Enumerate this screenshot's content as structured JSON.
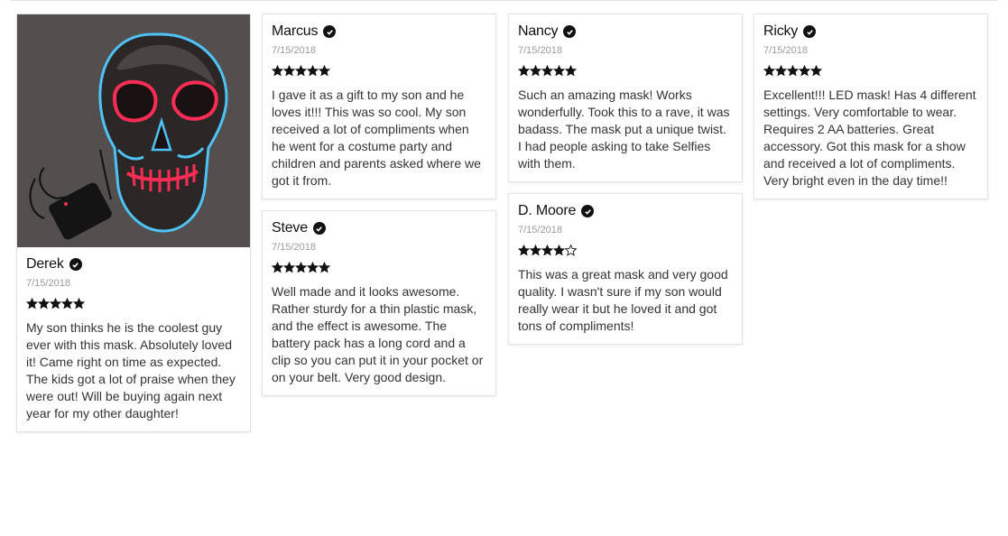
{
  "reviews": [
    {
      "name": "Derek",
      "date": "7/15/2018",
      "rating": 5,
      "text": "My son thinks he is the coolest guy ever with this mask. Absolutely loved it! Came right on time as expected. The kids got a lot of praise when they were out! Will be buying again next year for my other daughter!",
      "photo": "glowing-skull-mask-photo"
    },
    {
      "name": "Marcus",
      "date": "7/15/2018",
      "rating": 5,
      "text": "I gave it as a gift to my son and he loves it!!! This was so cool. My son received a lot of compliments when he went for a costume party and children and parents asked where we got it from."
    },
    {
      "name": "Steve",
      "date": "7/15/2018",
      "rating": 5,
      "text": "Well made and it looks awesome. Rather sturdy for a thin plastic mask, and the effect is awesome. The battery pack has a long cord and a clip so you can put it in your pocket or on your belt. Very good design."
    },
    {
      "name": "Nancy",
      "date": "7/15/2018",
      "rating": 5,
      "text": "Such an amazing mask! Works wonderfully. Took this to a rave, it was badass. The mask put a unique twist. I had people asking to take Selfies with them."
    },
    {
      "name": "D. Moore",
      "date": "7/15/2018",
      "rating": 4,
      "text": "This was a great mask and very good quality. I wasn't sure if my son would really wear it but he loved it and got tons of compliments!"
    },
    {
      "name": "Ricky",
      "date": "7/15/2018",
      "rating": 5,
      "text": "Excellent!!! LED mask! Has 4 different settings. Very comfortable to wear. Requires 2 AA batteries. Great accessory. Got this mask for a show and received a lot of compliments. Very bright even in the day time!!"
    }
  ],
  "icons": {
    "verified": "verified-check-icon",
    "star_filled": "star-filled-icon",
    "star_empty": "star-empty-icon"
  },
  "colors": {
    "mask_outline": "#4fc3f7",
    "mask_eyes": "#ff2d55",
    "photo_bg": "#4f4c4b"
  }
}
